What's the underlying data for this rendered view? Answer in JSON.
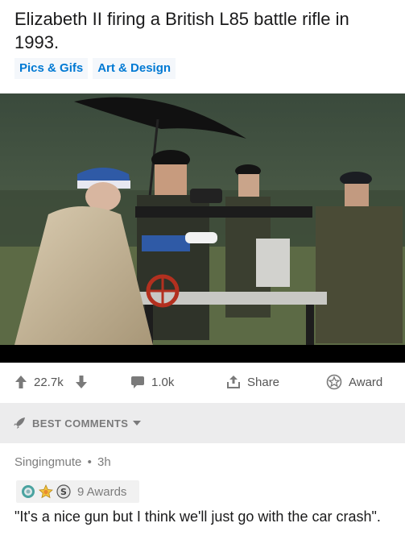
{
  "post": {
    "title": "Elizabeth II firing a British L85 battle rifle in 1993.",
    "flairs": [
      "Pics & Gifs",
      "Art & Design"
    ]
  },
  "actions": {
    "upvote_count": "22.7k",
    "comments_count": "1.0k",
    "share_label": "Share",
    "award_label": "Award"
  },
  "comments_section": {
    "sort_label": "BEST COMMENTS"
  },
  "comment": {
    "author": "Singingmute",
    "age": "3h",
    "separator": "•",
    "awards_label": "9 Awards",
    "body": "\"It's a nice gun but I think we'll just go with the car crash\"."
  },
  "colors": {
    "flair_text": "#0079d3",
    "flair_bg": "#f4f7fb",
    "sort_bar_bg": "#ececed",
    "text_primary": "#1a1a1b",
    "text_muted": "#7c7c7c"
  },
  "icons": {
    "upvote": "arrow-up-icon",
    "downvote": "arrow-down-icon",
    "comment": "speech-bubble-icon",
    "share": "share-upload-icon",
    "award": "star-award-icon",
    "sort": "rocket-icon",
    "sort_caret": "chevron-down-icon"
  }
}
